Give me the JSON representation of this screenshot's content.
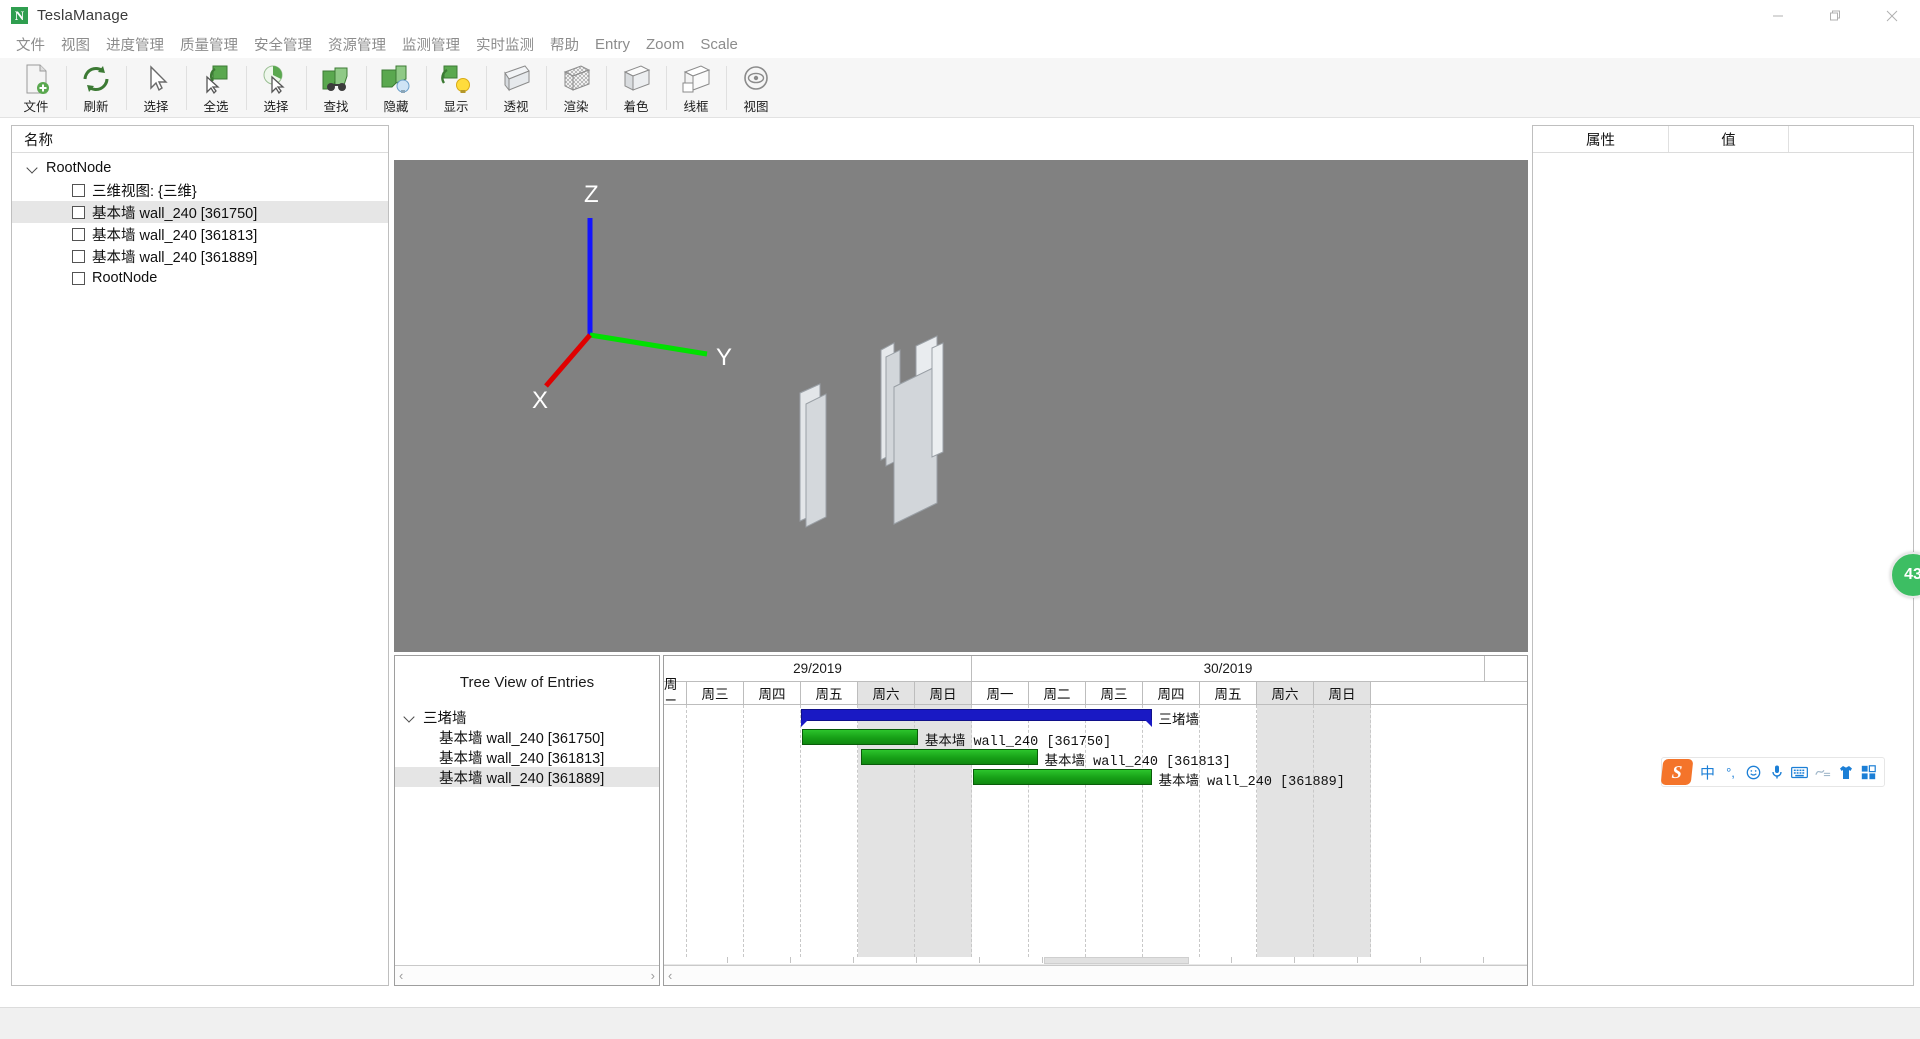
{
  "window": {
    "title": "TeslaManage",
    "logo_letter": "N",
    "buttons": [
      {
        "name": "minimize",
        "glyph": "minimize-icon"
      },
      {
        "name": "maximize",
        "glyph": "maximize-icon"
      },
      {
        "name": "close",
        "glyph": "close-icon"
      }
    ]
  },
  "menu": {
    "items": [
      {
        "label": "文件",
        "latin": false
      },
      {
        "label": "视图",
        "latin": false
      },
      {
        "label": "进度管理",
        "latin": false
      },
      {
        "label": "质量管理",
        "latin": false
      },
      {
        "label": "安全管理",
        "latin": false
      },
      {
        "label": "资源管理",
        "latin": false
      },
      {
        "label": "监测管理",
        "latin": false
      },
      {
        "label": "实时监测",
        "latin": false
      },
      {
        "label": "帮助",
        "latin": false
      },
      {
        "label": "Entry",
        "latin": true
      },
      {
        "label": "Zoom",
        "latin": true
      },
      {
        "label": "Scale",
        "latin": true
      }
    ]
  },
  "toolbar": {
    "buttons": [
      {
        "label": "文件",
        "icon": "new-file-icon"
      },
      {
        "label": "刷新",
        "icon": "refresh-icon"
      },
      {
        "label": "选择",
        "icon": "cursor-select-icon"
      },
      {
        "label": "全选",
        "icon": "select-all-icon"
      },
      {
        "label": "选择",
        "icon": "select-object-icon"
      },
      {
        "label": "查找",
        "icon": "binoculars-find-icon"
      },
      {
        "label": "隐藏",
        "icon": "hide-bulb-icon"
      },
      {
        "label": "显示",
        "icon": "show-bulb-icon"
      },
      {
        "label": "透视",
        "icon": "perspective-icon"
      },
      {
        "label": "渲染",
        "icon": "render-icon"
      },
      {
        "label": "着色",
        "icon": "shading-cube-icon"
      },
      {
        "label": "线框",
        "icon": "wireframe-cube-icon"
      },
      {
        "label": "视图",
        "icon": "view-target-icon"
      }
    ]
  },
  "left_panel": {
    "header": "名称",
    "root": {
      "label": "RootNode",
      "expanded": true
    },
    "items": [
      {
        "label": "三维视图: {三维}",
        "checked": false,
        "selected": false
      },
      {
        "label": "基本墙 wall_240 [361750]",
        "checked": false,
        "selected": true
      },
      {
        "label": "基本墙 wall_240 [361813]",
        "checked": false,
        "selected": false
      },
      {
        "label": "基本墙 wall_240 [361889]",
        "checked": false,
        "selected": false
      },
      {
        "label": "RootNode",
        "checked": false,
        "selected": false
      }
    ]
  },
  "viewport": {
    "axes": [
      {
        "label": "Z",
        "color": "#1414ff"
      },
      {
        "label": "Y",
        "color": "#00e000"
      },
      {
        "label": "X",
        "color": "#e00000"
      }
    ],
    "background_color": "#818181",
    "object_count": 3,
    "object_color": "#d6d9dc"
  },
  "entries_panel": {
    "title": "Tree View of Entries",
    "root": {
      "label": "三堵墙",
      "expanded": true
    },
    "items": [
      {
        "label": "基本墙 wall_240 [361750]",
        "selected": false
      },
      {
        "label": "基本墙 wall_240 [361813]",
        "selected": false
      },
      {
        "label": "基本墙 wall_240 [361889]",
        "selected": true
      }
    ],
    "scroll_left": "‹",
    "scroll_right": "›"
  },
  "gantt": {
    "months": [
      {
        "label": "29/2019",
        "span_days": 6
      },
      {
        "label": "30/2019",
        "span_days": 9
      }
    ],
    "days": [
      {
        "label": "周二",
        "weekend": false,
        "partial": true
      },
      {
        "label": "周三",
        "weekend": false
      },
      {
        "label": "周四",
        "weekend": false
      },
      {
        "label": "周五",
        "weekend": false
      },
      {
        "label": "周六",
        "weekend": true
      },
      {
        "label": "周日",
        "weekend": true
      },
      {
        "label": "周一",
        "weekend": false
      },
      {
        "label": "周二",
        "weekend": false
      },
      {
        "label": "周三",
        "weekend": false
      },
      {
        "label": "周四",
        "weekend": false
      },
      {
        "label": "周五",
        "weekend": false
      },
      {
        "label": "周六",
        "weekend": true
      },
      {
        "label": "周日",
        "weekend": true
      }
    ],
    "bars": [
      {
        "type": "summary",
        "label": "三堵墙",
        "start_col": 3.0,
        "end_col": 9.15,
        "row": 0,
        "color": "#1919c4"
      },
      {
        "type": "task",
        "label": "基本墙 wall_240 [361750]",
        "start_col": 3.02,
        "end_col": 5.05,
        "row": 1,
        "color": "#17a017"
      },
      {
        "type": "task",
        "label": "基本墙 wall_240 [361813]",
        "start_col": 4.05,
        "end_col": 7.15,
        "row": 2,
        "color": "#17a017"
      },
      {
        "type": "task",
        "label": "基本墙 wall_240 [361889]",
        "start_col": 6.02,
        "end_col": 9.15,
        "row": 3,
        "color": "#17a017"
      }
    ],
    "scroll_left": "‹"
  },
  "right_panel": {
    "columns": [
      "属性",
      "值",
      ""
    ]
  },
  "badge": {
    "value": "43"
  },
  "ime": {
    "logo": "S",
    "items": [
      {
        "name": "chinese-mode-icon",
        "glyph": "中"
      },
      {
        "name": "punctuation-icon",
        "glyph": "°,"
      },
      {
        "name": "emoji-icon",
        "glyph": "☺"
      },
      {
        "name": "voice-input-icon",
        "glyph": "mic"
      },
      {
        "name": "soft-keyboard-icon",
        "glyph": "keyboard"
      },
      {
        "name": "handwriting-icon",
        "glyph": "hand"
      },
      {
        "name": "skin-icon",
        "glyph": "shirt"
      },
      {
        "name": "toolbox-icon",
        "glyph": "grid"
      }
    ]
  }
}
